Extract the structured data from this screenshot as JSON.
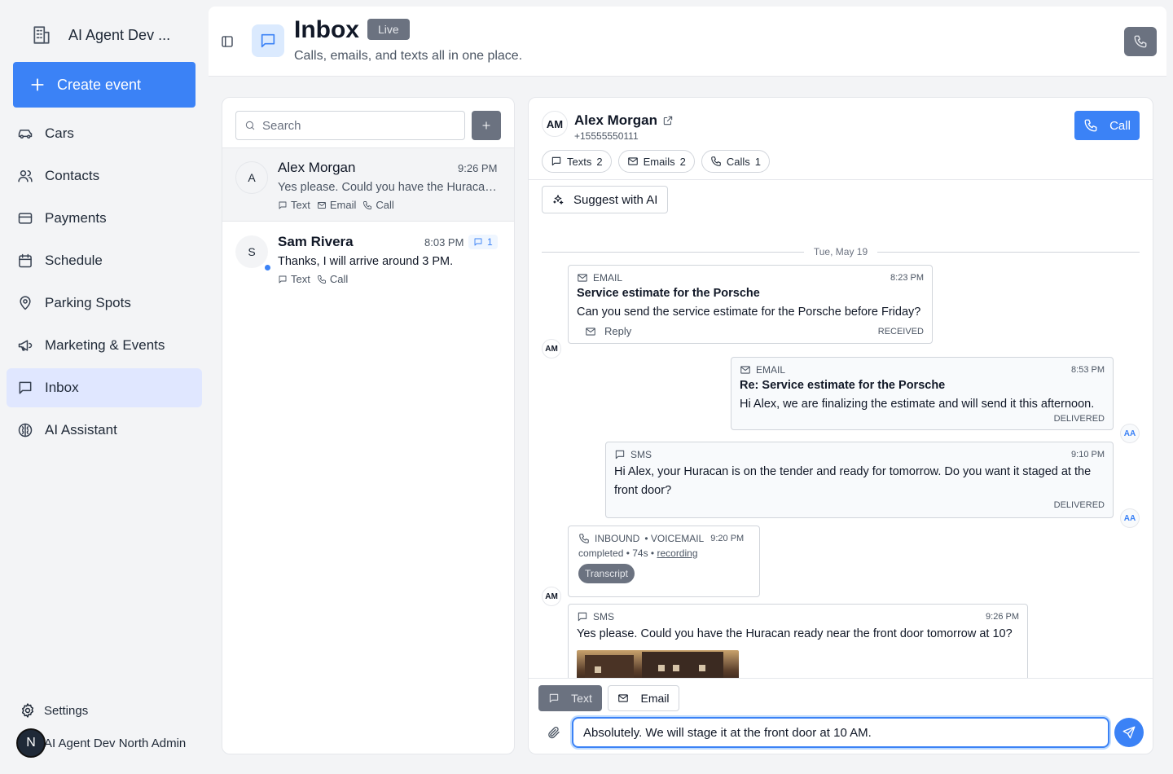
{
  "sidebar": {
    "org_name": "AI Agent Dev ...",
    "create_label": "Create event",
    "items": [
      {
        "label": "Cars"
      },
      {
        "label": "Contacts"
      },
      {
        "label": "Payments"
      },
      {
        "label": "Schedule"
      },
      {
        "label": "Parking Spots"
      },
      {
        "label": "Marketing & Events"
      },
      {
        "label": "Inbox",
        "active": true
      },
      {
        "label": "AI Assistant"
      }
    ],
    "settings_label": "Settings",
    "user_initial": "N",
    "user_name": "AI Agent Dev North Admin"
  },
  "header": {
    "title": "Inbox",
    "badge": "Live",
    "subtitle": "Calls, emails, and texts all in one place."
  },
  "list": {
    "search_placeholder": "Search",
    "conversations": [
      {
        "initial": "A",
        "name": "Alex Morgan",
        "time": "9:26 PM",
        "preview": "Yes please. Could you have the Huracan ready near the front door tomorrow at 10?",
        "channels": [
          "Text",
          "Email",
          "Call"
        ]
      },
      {
        "initial": "S",
        "name": "Sam Rivera",
        "time": "8:03 PM",
        "unread": "1",
        "preview": "Thanks, I will arrive around 3 PM.",
        "channels": [
          "Text",
          "Call"
        ]
      }
    ]
  },
  "thread": {
    "avatar": "AM",
    "name": "Alex Morgan",
    "phone": "+15555550111",
    "call_label": "Call",
    "chips": {
      "texts_label": "Texts",
      "texts_count": "2",
      "emails_label": "Emails",
      "emails_count": "2",
      "calls_label": "Calls",
      "calls_count": "1"
    },
    "suggest_label": "Suggest with AI",
    "date": "Tue, May 19",
    "messages": [
      {
        "type": "EMAIL",
        "time": "8:23 PM",
        "subject": "Service estimate for the Porsche",
        "body": "Can you send the service estimate for the Porsche before Friday?",
        "reply": "Reply",
        "status": "RECEIVED",
        "avatar": "AM"
      },
      {
        "type": "EMAIL",
        "time": "8:53 PM",
        "subject": "Re: Service estimate for the Porsche",
        "body": "Hi Alex, we are finalizing the estimate and will send it this afternoon.",
        "status": "DELIVERED",
        "avatar": "AA"
      },
      {
        "type": "SMS",
        "time": "9:10 PM",
        "body": "Hi Alex, your Huracan is on the tender and ready for tomorrow. Do you want it staged at the front door?",
        "status": "DELIVERED",
        "avatar": "AA"
      },
      {
        "type": "INBOUND",
        "subtype": "• VOICEMAIL",
        "time": "9:20 PM",
        "detail": "completed • 74s •",
        "recording": "recording",
        "transcript": "Transcript",
        "avatar": "AM"
      },
      {
        "type": "SMS",
        "time": "9:26 PM",
        "body": "Yes please. Could you have the Huracan ready near the front door tomorrow at 10?"
      }
    ],
    "composer": {
      "text_mode": "Text",
      "email_mode": "Email",
      "value": "Absolutely. We will stage it at the front door at 10 AM."
    }
  }
}
